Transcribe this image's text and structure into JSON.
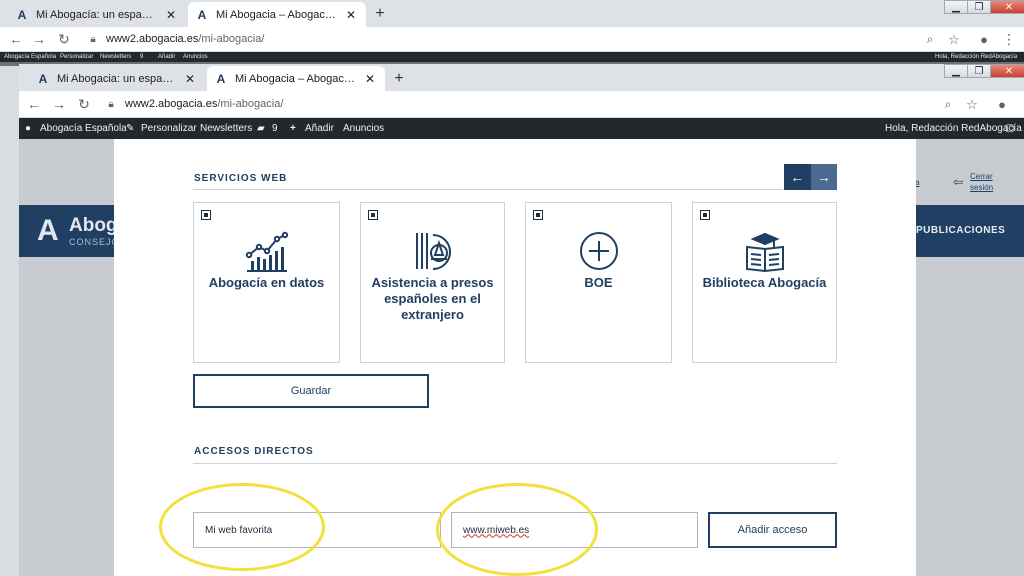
{
  "outer_browser": {
    "tabs": [
      {
        "label": "Mi Abogacía: un espacio personalizado",
        "active": false
      },
      {
        "label": "Mi Abogacia – Abogacía Española",
        "active": true
      }
    ],
    "new_tab": "+",
    "url": {
      "host": "www2.abogacia.es",
      "path": "/mi-abogacia/"
    },
    "window_controls": {
      "minimize": "▁",
      "maximize": "❐",
      "close": "✕"
    },
    "wp_bar": {
      "items": [
        "Abogacía Española",
        "Personalizar",
        "Newsletters",
        "9",
        "Añadir",
        "Anuncios"
      ],
      "greeting": "Hola, Redacción RedAbogacía"
    }
  },
  "inner_browser": {
    "tabs": [
      {
        "label": "Mi Abogacia: un espacio personalizado",
        "active": false
      },
      {
        "label": "Mi Abogacia – Abogacía Española",
        "active": true
      }
    ],
    "new_tab": "+",
    "url": {
      "host": "www2.abogacia.es",
      "path": "/mi-abogacia/"
    },
    "window_controls": {
      "minimize": "▁",
      "maximize": "❐",
      "close": "✕"
    },
    "wp_bar": {
      "site_name": "Abogacía Española",
      "customize": "Personalizar",
      "newsletters": "Newsletters",
      "comments_count": "9",
      "add_new": "Añadir",
      "ads": "Anuncios",
      "greeting": "Hola, Redacción RedAbogacía"
    }
  },
  "background_page": {
    "logo_text": "Aboga",
    "logo_sub": "CONSEJO",
    "publicaciones": "PUBLICACIONES",
    "logout": "Cerrar sesión",
    "link_fragment": "a"
  },
  "servicios_web": {
    "title": "SERVICIOS WEB",
    "prev_arrow": "←",
    "next_arrow": "→",
    "cards": [
      {
        "label": "Abogacía en datos",
        "icon": "chart-icon",
        "checked": true
      },
      {
        "label": "Asistencia a presos españoles en el extranjero",
        "icon": "prison-justice-icon",
        "checked": true
      },
      {
        "label": "BOE",
        "icon": "plus-circle-icon",
        "checked": true
      },
      {
        "label": "Biblioteca Abogacía",
        "icon": "book-icon",
        "checked": true
      }
    ],
    "save_button": "Guardar"
  },
  "accesos_directos": {
    "title": "ACCESOS DIRECTOS",
    "name_field_value": "Mi web favorita",
    "url_field_value": "www.miweb.es",
    "add_button": "Añadir acceso"
  },
  "colors": {
    "brand_navy": "#1f3f63",
    "highlight_yellow": "#f2e13a",
    "wp_bar": "#23282d"
  }
}
